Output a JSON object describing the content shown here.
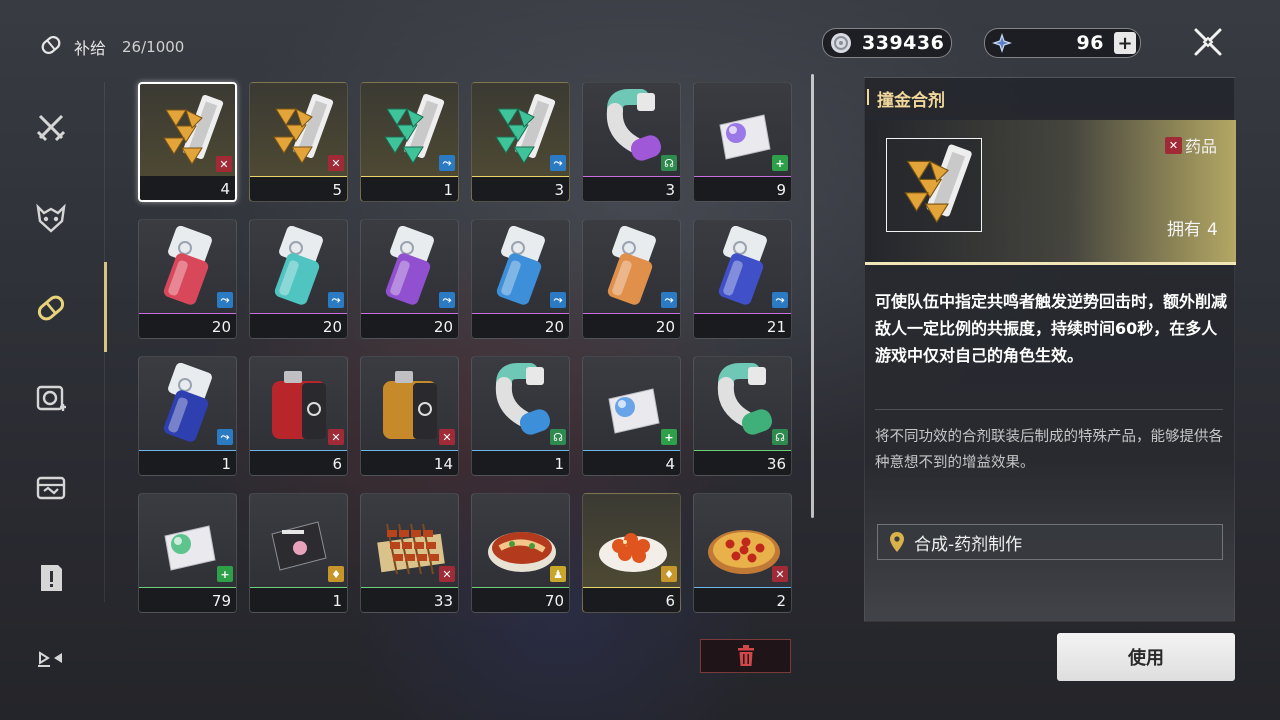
{
  "header": {
    "title": "补给",
    "count": "26/1000"
  },
  "sidebar": {
    "items": [
      {
        "name": "crossed-swords"
      },
      {
        "name": "demon-mask"
      },
      {
        "name": "supply-capsule",
        "active": true
      },
      {
        "name": "echo-device"
      },
      {
        "name": "quest-box"
      },
      {
        "name": "alert-page"
      },
      {
        "name": "special-mark"
      }
    ]
  },
  "currency": {
    "shell_credit": "339436",
    "astrite": "96",
    "add_symbol": "+"
  },
  "inventory": {
    "items": [
      {
        "qty": "4",
        "rarity": "#e9d56a",
        "cat": "red",
        "art": "gold-shards",
        "selected": true
      },
      {
        "qty": "5",
        "rarity": "#e9d56a",
        "cat": "red",
        "art": "gold-shards"
      },
      {
        "qty": "1",
        "rarity": "#e9d56a",
        "cat": "blue",
        "art": "green-shards"
      },
      {
        "qty": "3",
        "rarity": "#e9d56a",
        "cat": "blue",
        "art": "green-shards"
      },
      {
        "qty": "3",
        "rarity": "#c86ee0",
        "cat": "heal",
        "art": "tube-purple"
      },
      {
        "qty": "9",
        "rarity": "#c86ee0",
        "cat": "plus",
        "art": "packet-purple"
      },
      {
        "qty": "20",
        "rarity": "#c86ee0",
        "cat": "blue",
        "art": "vial-red"
      },
      {
        "qty": "20",
        "rarity": "#c86ee0",
        "cat": "blue",
        "art": "vial-teal"
      },
      {
        "qty": "20",
        "rarity": "#c86ee0",
        "cat": "blue",
        "art": "vial-purple"
      },
      {
        "qty": "20",
        "rarity": "#c86ee0",
        "cat": "blue",
        "art": "vial-blue"
      },
      {
        "qty": "20",
        "rarity": "#c86ee0",
        "cat": "blue",
        "art": "vial-orange"
      },
      {
        "qty": "21",
        "rarity": "#c86ee0",
        "cat": "blue",
        "art": "vial-indigo"
      },
      {
        "qty": "1",
        "rarity": "#6fb7e8",
        "cat": "blue",
        "art": "vial-navy"
      },
      {
        "qty": "6",
        "rarity": "#6fb7e8",
        "cat": "red",
        "art": "canister-red"
      },
      {
        "qty": "14",
        "rarity": "#6fb7e8",
        "cat": "red",
        "art": "canister-gold"
      },
      {
        "qty": "1",
        "rarity": "#6fb7e8",
        "cat": "heal",
        "art": "tube-blue"
      },
      {
        "qty": "4",
        "rarity": "#6fb7e8",
        "cat": "plus",
        "art": "packet-blue"
      },
      {
        "qty": "36",
        "rarity": "#6fd07a",
        "cat": "heal",
        "art": "tube-green"
      },
      {
        "qty": "79",
        "rarity": "#6fd07a",
        "cat": "plus",
        "art": "packet-green"
      },
      {
        "qty": "1",
        "rarity": "#6fd07a",
        "cat": "gold",
        "art": "packet-dark"
      },
      {
        "qty": "33",
        "rarity": "#6fd07a",
        "cat": "red",
        "art": "skewers"
      },
      {
        "qty": "70",
        "rarity": "#6fd07a",
        "cat": "person",
        "art": "soup-bowl"
      },
      {
        "qty": "6",
        "rarity": "#e9d56a",
        "cat": "gold",
        "art": "shrimp-plate"
      },
      {
        "qty": "2",
        "rarity": "#6fb7e8",
        "cat": "red",
        "art": "pizza"
      }
    ]
  },
  "detail": {
    "name": "撞金合剂",
    "tag": "药品",
    "owned_label": "拥有",
    "owned_count": "4",
    "description": "可使队伍中指定共鸣者触发逆势回击时，额外削减敌人一定比例的共振度，持续时间60秒，在多人游戏中仅对自己的角色生效。",
    "lore": "将不同功效的合剂联装后制成的特殊产品，能够提供各种意想不到的增益效果。",
    "source": "合成-药剂制作"
  },
  "actions": {
    "use": "使用"
  }
}
